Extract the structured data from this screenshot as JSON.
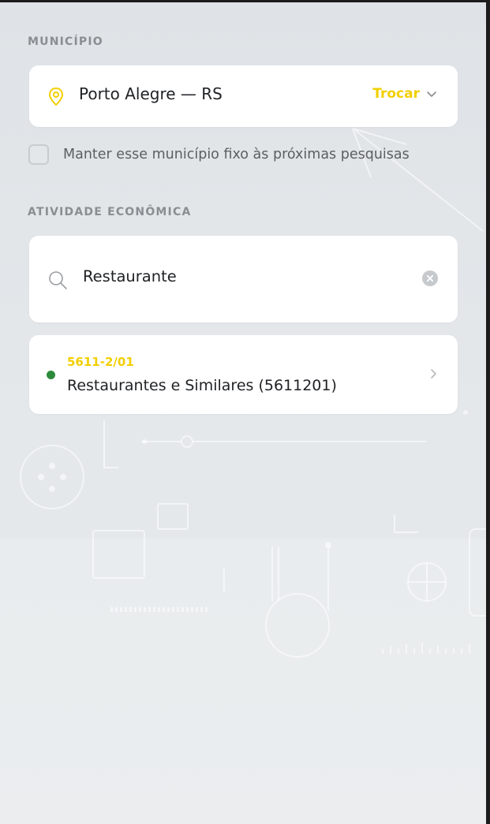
{
  "municipio": {
    "section_label": "MUNICÍPIO",
    "city": "Porto Alegre — RS",
    "change_label": "Trocar",
    "keep_fixed_label": "Manter esse município fixo às próximas pesquisas",
    "keep_fixed_checked": false
  },
  "atividade": {
    "section_label": "ATIVIDADE ECONÔMICA",
    "search_value": "Restaurante",
    "results": [
      {
        "code": "5611-2/01",
        "name": "Restaurantes e Similares (5611201)",
        "status": "active"
      }
    ]
  },
  "icons": {
    "pin": "map-pin-icon",
    "chevron_down": "chevron-down-icon",
    "search": "search-icon",
    "clear": "clear-icon",
    "chevron_right": "chevron-right-icon"
  },
  "colors": {
    "accent": "#f2cf00",
    "status_active": "#2e8b3d",
    "background": "#e3e7ea",
    "card": "#ffffff",
    "label": "#8a8d91"
  }
}
